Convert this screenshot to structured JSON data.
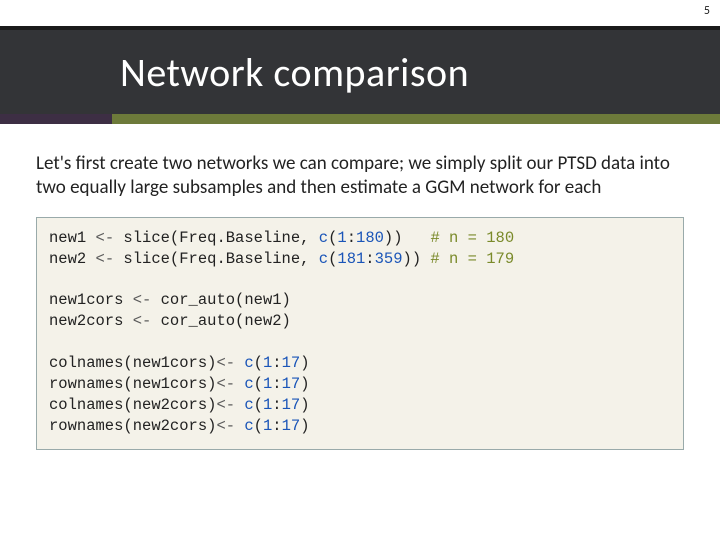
{
  "page_number": "5",
  "title": "Network comparison",
  "paragraph": "Let's first create two networks we can compare; we simply split our PTSD data into two equally large subsamples and then estimate a GGM network for each",
  "code": {
    "l1_a": "new1 ",
    "l1_op": "<-",
    "l1_b": " slice(Freq.Baseline, ",
    "l1_cfn": "c",
    "l1_po": "(",
    "l1_n1": "1",
    "l1_colon": ":",
    "l1_n2": "180",
    "l1_pc": "))   ",
    "l1_cmt": "# n = 180",
    "l2_a": "new2 ",
    "l2_op": "<-",
    "l2_b": " slice(Freq.Baseline, ",
    "l2_cfn": "c",
    "l2_po": "(",
    "l2_n1": "181",
    "l2_colon": ":",
    "l2_n2": "359",
    "l2_pc": ")) ",
    "l2_cmt": "# n = 179",
    "l4_a": "new1cors ",
    "l4_op": "<-",
    "l4_b": " cor_auto(new1)",
    "l5_a": "new2cors ",
    "l5_op": "<-",
    "l5_b": " cor_auto(new2)",
    "l7_a": "colnames(new1cors)",
    "l7_op": "<-",
    "l7_sp": " ",
    "l7_cfn": "c",
    "l7_po": "(",
    "l7_n1": "1",
    "l7_colon": ":",
    "l7_n2": "17",
    "l7_pc": ")",
    "l8_a": "rownames(new1cors)",
    "l8_op": "<-",
    "l8_sp": " ",
    "l8_cfn": "c",
    "l8_po": "(",
    "l8_n1": "1",
    "l8_colon": ":",
    "l8_n2": "17",
    "l8_pc": ")",
    "l9_a": "colnames(new2cors)",
    "l9_op": "<-",
    "l9_sp": " ",
    "l9_cfn": "c",
    "l9_po": "(",
    "l9_n1": "1",
    "l9_colon": ":",
    "l9_n2": "17",
    "l9_pc": ")",
    "l10_a": "rownames(new2cors)",
    "l10_op": "<-",
    "l10_sp": " ",
    "l10_cfn": "c",
    "l10_po": "(",
    "l10_n1": "1",
    "l10_colon": ":",
    "l10_n2": "17",
    "l10_pc": ")"
  }
}
